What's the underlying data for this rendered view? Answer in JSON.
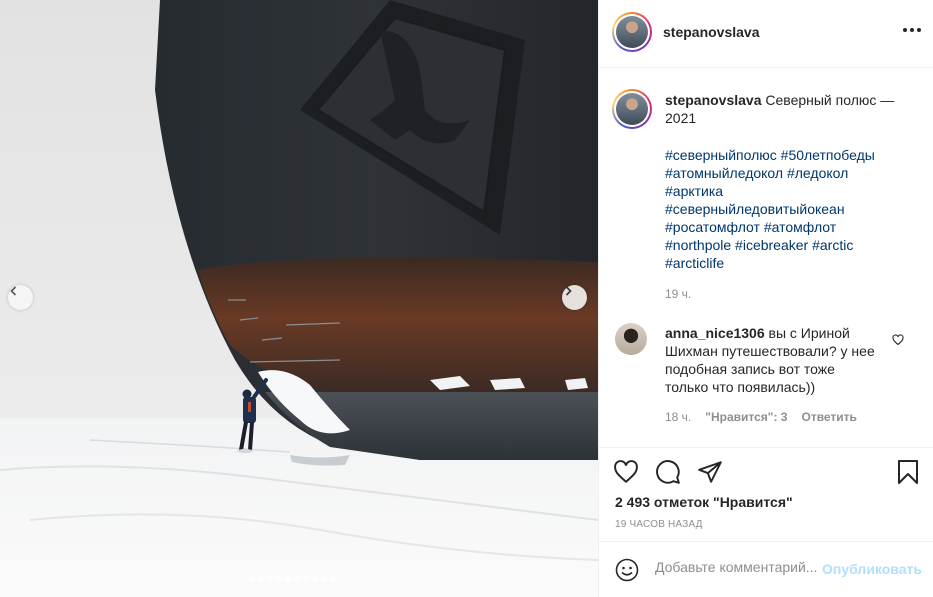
{
  "post": {
    "author": "stepanovslava",
    "caption": "Северный полюс — 2021",
    "hashtags": [
      "#северныйполюс #50летпобеды",
      "#атомныйледокол #ледокол",
      "#арктика",
      "#северныйледовитыйокеан",
      "#росатомфлот #атомфлот",
      "#northpole #icebreaker #arctic",
      "#arcticlife"
    ],
    "caption_time": "19 ч.",
    "likes": "2 493 отметок \"Нравится\"",
    "date": "19 ЧАСОВ НАЗАД"
  },
  "carousel": {
    "total": 10,
    "active_index": 4
  },
  "comment": {
    "user": "anna_nice1306",
    "text": "вы с Ириной Шихман путешествовали? у нее подобная запись вот тоже только что появилась))",
    "time": "18 ч.",
    "likes_label": "\"Нравится\": 3",
    "reply_label": "Ответить"
  },
  "composer": {
    "placeholder": "Добавьте комментарий...",
    "publish": "Опубликовать"
  },
  "icons": [
    "chevron-left-icon",
    "chevron-right-icon",
    "more-icon",
    "heart-icon",
    "comment-icon",
    "share-icon",
    "bookmark-icon",
    "emoji-icon"
  ],
  "colors": {
    "link": "#00376b",
    "muted": "#8e8e8e",
    "publish_disabled": "#b2dffc",
    "text": "#262626"
  }
}
